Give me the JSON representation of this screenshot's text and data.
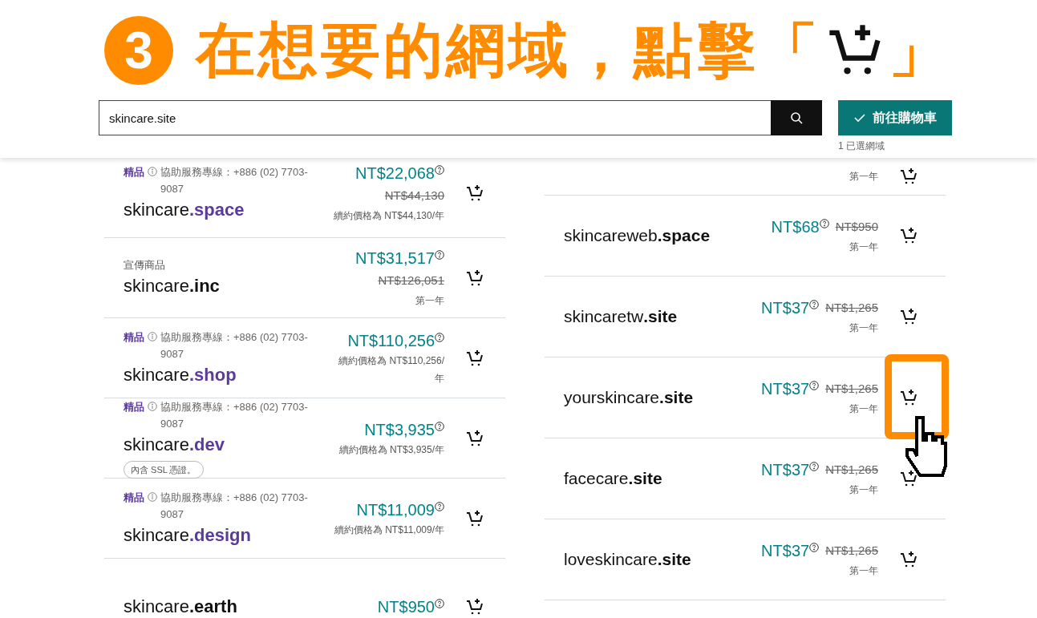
{
  "heading": {
    "step": "3",
    "text": "在想要的網域，點擊「",
    "close": "」"
  },
  "search": {
    "value": "skincare.site"
  },
  "cart_button": {
    "label": "前往購物車",
    "note": "1 已選網域"
  },
  "left_results": [
    {
      "kind": "premium",
      "tag": "精品",
      "info": "協助服務專線：+886 (02) 7703-9087",
      "name": "skincare",
      "tld": ".space",
      "price": "NT$22,068",
      "original": "NT$44,130",
      "renewal": "續約價格為 NT$44,130/年"
    },
    {
      "kind": "promo",
      "tag": "宣傳商品",
      "name": "skincare",
      "tld": ".inc",
      "price": "NT$31,517",
      "original": "NT$126,051",
      "term": "第一年"
    },
    {
      "kind": "premium",
      "tag": "精品",
      "info": "協助服務專線：+886 (02) 7703-9087",
      "name": "skincare",
      "tld": ".shop",
      "price": "NT$110,256",
      "renewal": "續約價格為 NT$110,256/年"
    },
    {
      "kind": "premium",
      "tag": "精品",
      "info": "協助服務專線：+886 (02) 7703-9087",
      "name": "skincare",
      "tld": ".dev",
      "badge": "內含 SSL 憑證。",
      "price": "NT$3,935",
      "renewal": "續約價格為 NT$3,935/年"
    },
    {
      "kind": "premium",
      "tag": "精品",
      "info": "協助服務專線：+886 (02) 7703-9087",
      "name": "skincare",
      "tld": ".design",
      "price": "NT$11,009",
      "renewal": "續約價格為 NT$11,009/年"
    },
    {
      "kind": "plain",
      "name": "skincare",
      "tld": ".earth",
      "price": "NT$950"
    }
  ],
  "right_results": [
    {
      "term": "第一年"
    },
    {
      "name": "skincareweb",
      "tld": ".space",
      "price": "NT$68",
      "original": "NT$950",
      "term": "第一年"
    },
    {
      "name": "skincaretw",
      "tld": ".site",
      "price": "NT$37",
      "original": "NT$1,265",
      "term": "第一年"
    },
    {
      "name": "yourskincare",
      "tld": ".site",
      "price": "NT$37",
      "original": "NT$1,265",
      "term": "第一年",
      "highlighted": true
    },
    {
      "name": "facecare",
      "tld": ".site",
      "price": "NT$37",
      "original": "NT$1,265",
      "term": "第一年"
    },
    {
      "name": "loveskincare",
      "tld": ".site",
      "price": "NT$37",
      "original": "NT$1,265",
      "term": "第一年"
    }
  ]
}
